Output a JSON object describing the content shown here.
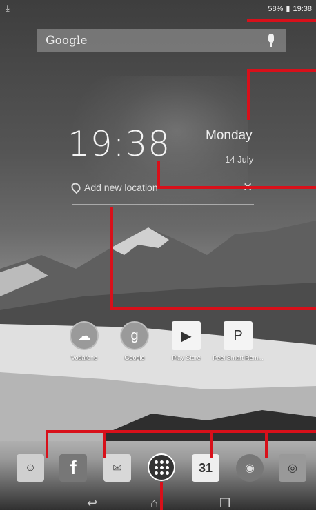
{
  "status_bar": {
    "battery": "58%",
    "time": "19:38"
  },
  "search": {
    "logo": "Google"
  },
  "clock_widget": {
    "time": "19:38",
    "day": "Monday",
    "date": "14 July",
    "location_prompt": "Add new location"
  },
  "apps": [
    {
      "label": "Vodafone",
      "icon": "vodafone-icon"
    },
    {
      "label": "Google",
      "icon": "google-folder-icon"
    },
    {
      "label": "Play Store",
      "icon": "play-store-icon"
    },
    {
      "label": "Peel Smart Rem...",
      "icon": "peel-smart-remote-icon"
    }
  ],
  "dock": {
    "items": [
      "contacts-icon",
      "facebook-icon",
      "email-icon",
      "all-apps-icon",
      "calendar-icon",
      "browser-icon",
      "camera-icon"
    ],
    "calendar_day": "31"
  },
  "colors": {
    "callout_red": "#d8101a"
  }
}
